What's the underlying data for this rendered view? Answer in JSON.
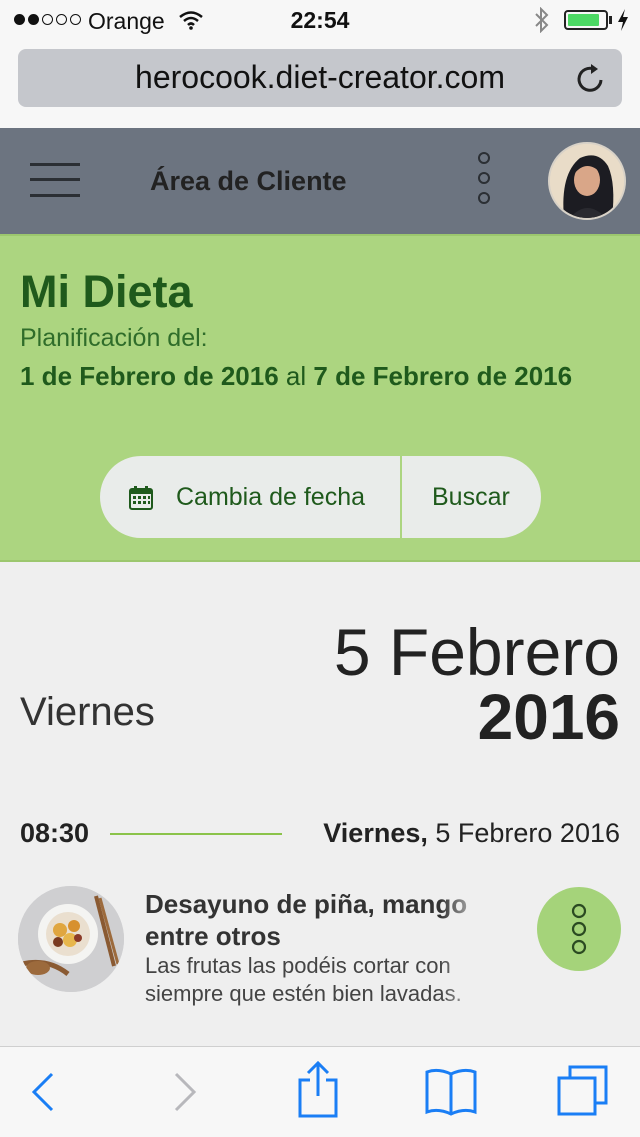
{
  "status_bar": {
    "carrier": "Orange",
    "time": "22:54",
    "signal_bars": 2,
    "battery_level": 0.85,
    "icons": [
      "signal-icon",
      "wifi-icon",
      "bluetooth-icon",
      "battery-icon",
      "charging-icon"
    ]
  },
  "browser": {
    "url": "herocook.diet-creator.com",
    "toolbar_icons": [
      "back-icon",
      "forward-icon",
      "share-icon",
      "bookmarks-icon",
      "tabs-icon"
    ]
  },
  "header": {
    "title": "Área de Cliente",
    "icons": [
      "menu-icon",
      "more-icon",
      "avatar"
    ]
  },
  "diet": {
    "title": "Mi Dieta",
    "plan_label": "Planificación del:",
    "start_date": "1 de Febrero de 2016",
    "connector": "al",
    "end_date": "7 de Febrero de 2016",
    "change_date_button": "Cambia de fecha",
    "search_button": "Buscar"
  },
  "day": {
    "weekday": "Viernes",
    "day_month": "5 Febrero",
    "year": "2016"
  },
  "meal": {
    "time": "08:30",
    "weekday": "Viernes,",
    "date": "5 Febrero 2016",
    "title": "Desayuno de piña, mango entre otros",
    "description": "Las frutas las podéis cortar con siempre que estén bien lavadas."
  },
  "colors": {
    "header_bg": "#6c7480",
    "panel_green": "#acd580",
    "dark_green": "#1f5a1c",
    "accent_line": "#8bc34a",
    "ios_blue": "#1a7ef5"
  }
}
